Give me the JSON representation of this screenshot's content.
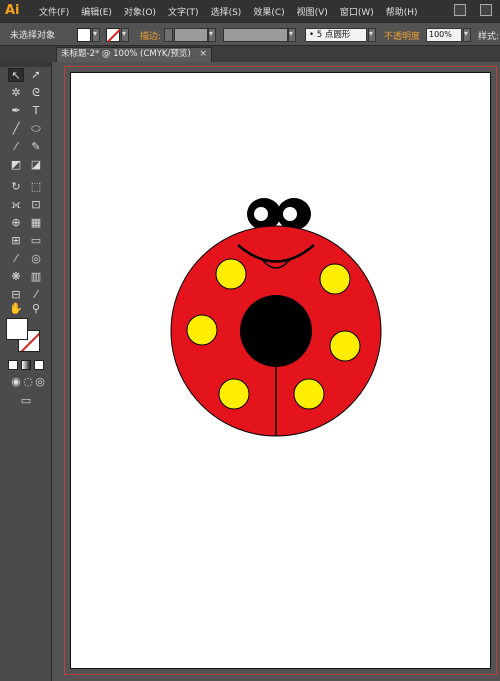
{
  "app": {
    "logo": "Ai"
  },
  "menu": {
    "items": [
      "文件(F)",
      "编辑(E)",
      "对象(O)",
      "文字(T)",
      "选择(S)",
      "效果(C)",
      "视图(V)",
      "窗口(W)",
      "帮助(H)"
    ]
  },
  "control_bar": {
    "selection_status": "未选择对象",
    "stroke_label": "描边:",
    "brush_value": "• 5 点圆形",
    "opacity_label": "不透明度",
    "opacity_value": "100%",
    "style_label": "样式:"
  },
  "document_tab": {
    "title": "未标题-2* @ 100% (CMYK/预览)",
    "close": "×"
  },
  "colors": {
    "ladybug_body": "#e3141c",
    "spots": "#ffee00",
    "black": "#000000",
    "bleed_guide": "#c04040",
    "accent_label": "#f0a030"
  },
  "toolbar": {
    "tools": [
      "selection-tool",
      "direct-selection-tool",
      "magic-wand-tool",
      "lasso-tool",
      "pen-tool",
      "type-tool",
      "line-tool",
      "ellipse-tool",
      "paintbrush-tool",
      "pencil-tool",
      "blob-brush-tool",
      "eraser-tool",
      "rotate-tool",
      "scale-tool",
      "width-tool",
      "free-transform-tool",
      "shape-builder-tool",
      "perspective-grid-tool",
      "mesh-tool",
      "gradient-tool",
      "eyedropper-tool",
      "blend-tool",
      "symbol-sprayer-tool",
      "column-graph-tool",
      "artboard-tool",
      "slice-tool",
      "hand-tool",
      "zoom-tool"
    ]
  }
}
